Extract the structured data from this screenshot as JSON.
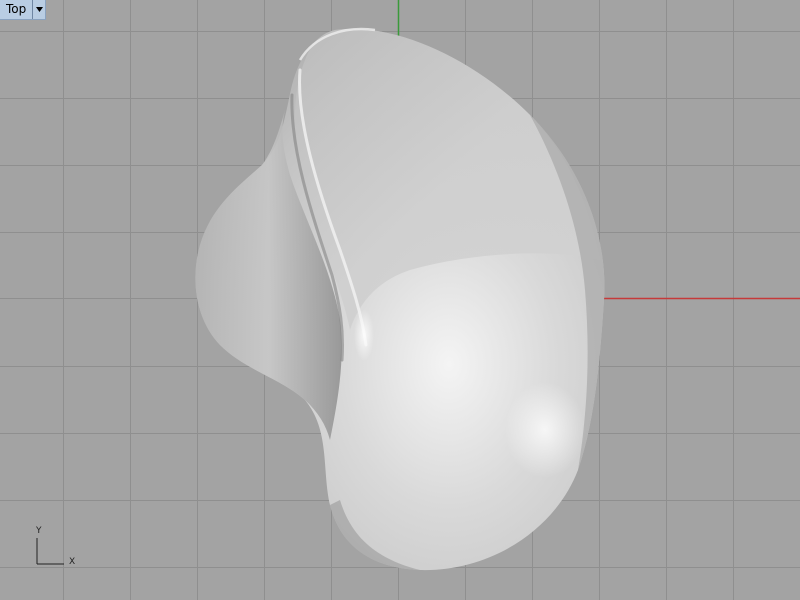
{
  "viewport": {
    "name": "Top",
    "background_color": "#a3a3a3",
    "grid_color": "#8f8f8f",
    "x_axis_color": "#c53a3a",
    "y_axis_color": "#3a9a3a",
    "dropdown_icon": "triangle-down-icon"
  },
  "axis_widget": {
    "y_label": "Y",
    "x_label": "X"
  },
  "model": {
    "type": "freeform-surface",
    "shading": "rendered-white"
  }
}
